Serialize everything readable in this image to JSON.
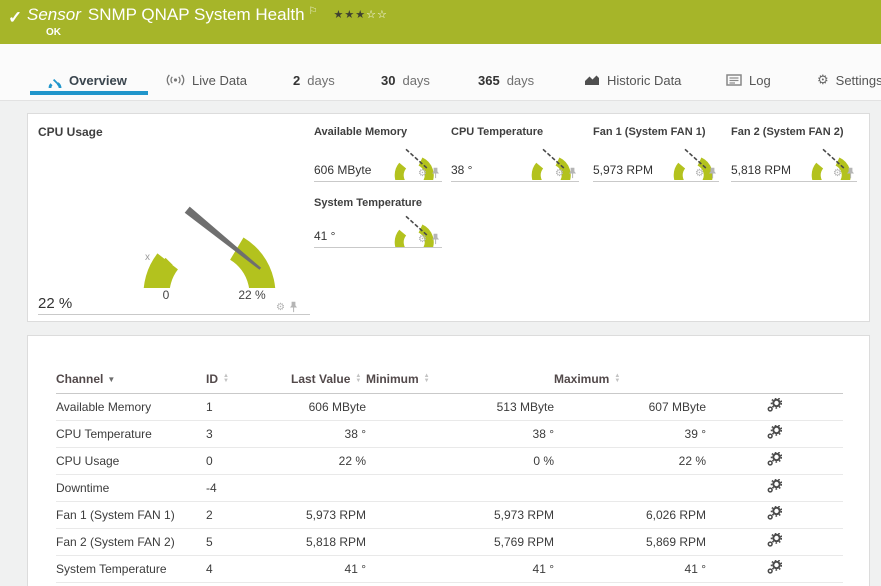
{
  "colors": {
    "header_green": "#a6b529",
    "gauge_green": "#b3c21e",
    "active_tab_blue": "#2196cb",
    "status_ok_green": "#a6b529"
  },
  "icons": {
    "check": "✓",
    "flag": "⚐",
    "gear": "⚙",
    "sort_desc": "▼",
    "sort_up": "▲",
    "sort_down": "▼"
  },
  "header": {
    "type_label": "Sensor",
    "title": "SNMP QNAP System Health",
    "status": "OK",
    "stars_filled": "★★★",
    "stars_empty": "☆☆"
  },
  "tabs": {
    "overview": {
      "label": "Overview"
    },
    "live_data": {
      "label": "Live Data"
    },
    "days2": {
      "num": "2",
      "word": "days"
    },
    "days30": {
      "num": "30",
      "word": "days"
    },
    "days365": {
      "num": "365",
      "word": "days"
    },
    "historic": {
      "label": "Historic Data"
    },
    "log": {
      "label": "Log"
    },
    "settings": {
      "label": "Settings"
    }
  },
  "gauges": {
    "main": {
      "title": "CPU Usage",
      "value": "22 %",
      "scale_min": "0",
      "scale_max": "22 %",
      "axis_marker": "x"
    },
    "small": [
      {
        "name": "Available Memory",
        "value": "606 MByte"
      },
      {
        "name": "CPU Temperature",
        "value": "38 °"
      },
      {
        "name": "Fan 1 (System FAN 1)",
        "value": "5,973 RPM"
      },
      {
        "name": "Fan 2 (System FAN 2)",
        "value": "5,818 RPM"
      },
      {
        "name": "System Temperature",
        "value": "41 °"
      }
    ]
  },
  "table": {
    "columns": [
      {
        "label": "Channel"
      },
      {
        "label": "ID"
      },
      {
        "label": "Last Value"
      },
      {
        "label": "Minimum"
      },
      {
        "label": "Maximum"
      }
    ],
    "rows": [
      {
        "channel": "Available Memory",
        "id": "1",
        "last": "606 MByte",
        "min": "513 MByte",
        "max": "607 MByte"
      },
      {
        "channel": "CPU Temperature",
        "id": "3",
        "last": "38 °",
        "min": "38 °",
        "max": "39 °"
      },
      {
        "channel": "CPU Usage",
        "id": "0",
        "last": "22 %",
        "min": "0 %",
        "max": "22 %"
      },
      {
        "channel": "Downtime",
        "id": "-4",
        "last": "",
        "min": "",
        "max": ""
      },
      {
        "channel": "Fan 1 (System FAN 1)",
        "id": "2",
        "last": "5,973 RPM",
        "min": "5,973 RPM",
        "max": "6,026 RPM"
      },
      {
        "channel": "Fan 2 (System FAN 2)",
        "id": "5",
        "last": "5,818 RPM",
        "min": "5,769 RPM",
        "max": "5,869 RPM"
      },
      {
        "channel": "System Temperature",
        "id": "4",
        "last": "41 °",
        "min": "41 °",
        "max": "41 °"
      }
    ]
  }
}
